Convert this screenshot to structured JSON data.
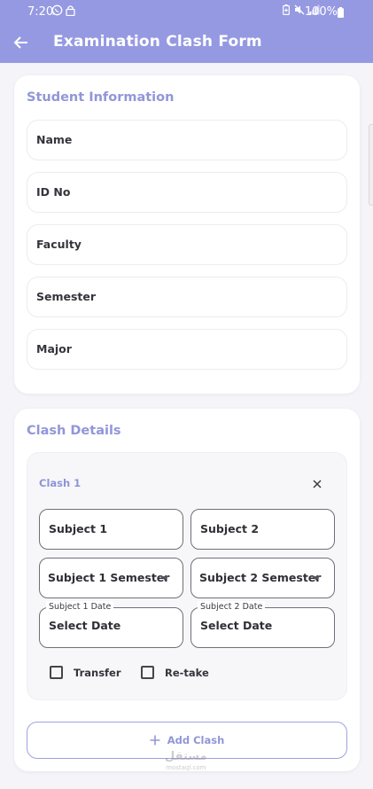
{
  "status_bar": {
    "time": "7:20",
    "battery": "100%",
    "left_icons": [
      "whatsapp-icon",
      "lock-icon"
    ],
    "right_icons": [
      "battery-saver-icon",
      "mute-icon",
      "signal-icon",
      "battery-icon"
    ]
  },
  "app_bar": {
    "title": "Examination Clash Form",
    "back_icon": "arrow-left-icon",
    "color": "#9599e2"
  },
  "student_info": {
    "title": "Student Information",
    "fields": [
      {
        "placeholder": "Name"
      },
      {
        "placeholder": "ID No"
      },
      {
        "placeholder": "Faculty"
      },
      {
        "placeholder": "Semester"
      },
      {
        "placeholder": "Major"
      }
    ]
  },
  "clash_details": {
    "title": "Clash Details",
    "clashes": [
      {
        "label": "Clash 1",
        "subject1_placeholder": "Subject 1",
        "subject2_placeholder": "Subject 2",
        "subject1_semester": "Subject 1 Semester",
        "subject2_semester": "Subject 2 Semester",
        "subject1_date_label": "Subject 1 Date",
        "subject1_date_value": "Select Date",
        "subject2_date_label": "Subject 2 Date",
        "subject2_date_value": "Select Date",
        "options": [
          {
            "label": "Transfer",
            "checked": false
          },
          {
            "label": "Re-take",
            "checked": false
          }
        ]
      }
    ],
    "add_button": "Add Clash"
  },
  "watermark": {
    "text": "مستقل",
    "subtext": "mostaql.com"
  },
  "colors": {
    "accent": "#9296d8",
    "background": "#f4f4f9",
    "card": "#ffffff"
  }
}
